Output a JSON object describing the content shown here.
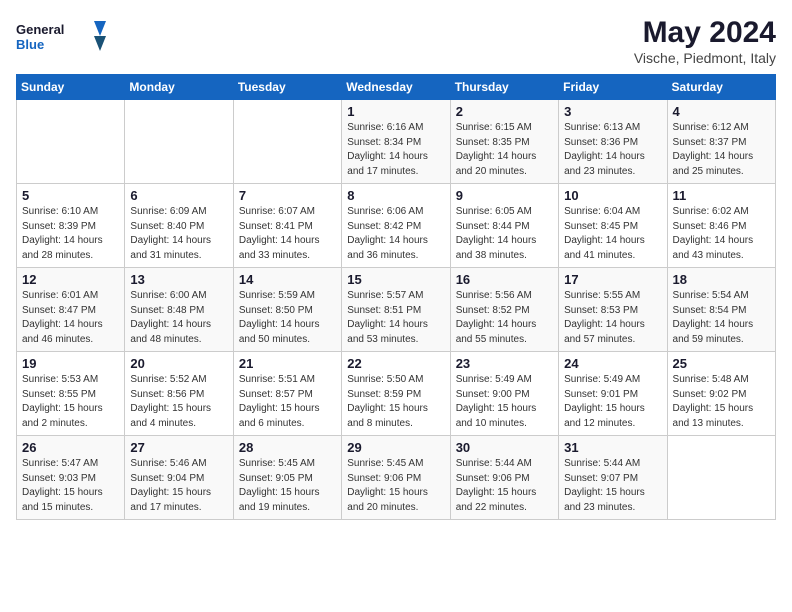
{
  "logo": {
    "general": "General",
    "blue": "Blue"
  },
  "title": "May 2024",
  "subtitle": "Vische, Piedmont, Italy",
  "days_of_week": [
    "Sunday",
    "Monday",
    "Tuesday",
    "Wednesday",
    "Thursday",
    "Friday",
    "Saturday"
  ],
  "weeks": [
    [
      {
        "day": "",
        "info": ""
      },
      {
        "day": "",
        "info": ""
      },
      {
        "day": "",
        "info": ""
      },
      {
        "day": "1",
        "info": "Sunrise: 6:16 AM\nSunset: 8:34 PM\nDaylight: 14 hours\nand 17 minutes."
      },
      {
        "day": "2",
        "info": "Sunrise: 6:15 AM\nSunset: 8:35 PM\nDaylight: 14 hours\nand 20 minutes."
      },
      {
        "day": "3",
        "info": "Sunrise: 6:13 AM\nSunset: 8:36 PM\nDaylight: 14 hours\nand 23 minutes."
      },
      {
        "day": "4",
        "info": "Sunrise: 6:12 AM\nSunset: 8:37 PM\nDaylight: 14 hours\nand 25 minutes."
      }
    ],
    [
      {
        "day": "5",
        "info": "Sunrise: 6:10 AM\nSunset: 8:39 PM\nDaylight: 14 hours\nand 28 minutes."
      },
      {
        "day": "6",
        "info": "Sunrise: 6:09 AM\nSunset: 8:40 PM\nDaylight: 14 hours\nand 31 minutes."
      },
      {
        "day": "7",
        "info": "Sunrise: 6:07 AM\nSunset: 8:41 PM\nDaylight: 14 hours\nand 33 minutes."
      },
      {
        "day": "8",
        "info": "Sunrise: 6:06 AM\nSunset: 8:42 PM\nDaylight: 14 hours\nand 36 minutes."
      },
      {
        "day": "9",
        "info": "Sunrise: 6:05 AM\nSunset: 8:44 PM\nDaylight: 14 hours\nand 38 minutes."
      },
      {
        "day": "10",
        "info": "Sunrise: 6:04 AM\nSunset: 8:45 PM\nDaylight: 14 hours\nand 41 minutes."
      },
      {
        "day": "11",
        "info": "Sunrise: 6:02 AM\nSunset: 8:46 PM\nDaylight: 14 hours\nand 43 minutes."
      }
    ],
    [
      {
        "day": "12",
        "info": "Sunrise: 6:01 AM\nSunset: 8:47 PM\nDaylight: 14 hours\nand 46 minutes."
      },
      {
        "day": "13",
        "info": "Sunrise: 6:00 AM\nSunset: 8:48 PM\nDaylight: 14 hours\nand 48 minutes."
      },
      {
        "day": "14",
        "info": "Sunrise: 5:59 AM\nSunset: 8:50 PM\nDaylight: 14 hours\nand 50 minutes."
      },
      {
        "day": "15",
        "info": "Sunrise: 5:57 AM\nSunset: 8:51 PM\nDaylight: 14 hours\nand 53 minutes."
      },
      {
        "day": "16",
        "info": "Sunrise: 5:56 AM\nSunset: 8:52 PM\nDaylight: 14 hours\nand 55 minutes."
      },
      {
        "day": "17",
        "info": "Sunrise: 5:55 AM\nSunset: 8:53 PM\nDaylight: 14 hours\nand 57 minutes."
      },
      {
        "day": "18",
        "info": "Sunrise: 5:54 AM\nSunset: 8:54 PM\nDaylight: 14 hours\nand 59 minutes."
      }
    ],
    [
      {
        "day": "19",
        "info": "Sunrise: 5:53 AM\nSunset: 8:55 PM\nDaylight: 15 hours\nand 2 minutes."
      },
      {
        "day": "20",
        "info": "Sunrise: 5:52 AM\nSunset: 8:56 PM\nDaylight: 15 hours\nand 4 minutes."
      },
      {
        "day": "21",
        "info": "Sunrise: 5:51 AM\nSunset: 8:57 PM\nDaylight: 15 hours\nand 6 minutes."
      },
      {
        "day": "22",
        "info": "Sunrise: 5:50 AM\nSunset: 8:59 PM\nDaylight: 15 hours\nand 8 minutes."
      },
      {
        "day": "23",
        "info": "Sunrise: 5:49 AM\nSunset: 9:00 PM\nDaylight: 15 hours\nand 10 minutes."
      },
      {
        "day": "24",
        "info": "Sunrise: 5:49 AM\nSunset: 9:01 PM\nDaylight: 15 hours\nand 12 minutes."
      },
      {
        "day": "25",
        "info": "Sunrise: 5:48 AM\nSunset: 9:02 PM\nDaylight: 15 hours\nand 13 minutes."
      }
    ],
    [
      {
        "day": "26",
        "info": "Sunrise: 5:47 AM\nSunset: 9:03 PM\nDaylight: 15 hours\nand 15 minutes."
      },
      {
        "day": "27",
        "info": "Sunrise: 5:46 AM\nSunset: 9:04 PM\nDaylight: 15 hours\nand 17 minutes."
      },
      {
        "day": "28",
        "info": "Sunrise: 5:45 AM\nSunset: 9:05 PM\nDaylight: 15 hours\nand 19 minutes."
      },
      {
        "day": "29",
        "info": "Sunrise: 5:45 AM\nSunset: 9:06 PM\nDaylight: 15 hours\nand 20 minutes."
      },
      {
        "day": "30",
        "info": "Sunrise: 5:44 AM\nSunset: 9:06 PM\nDaylight: 15 hours\nand 22 minutes."
      },
      {
        "day": "31",
        "info": "Sunrise: 5:44 AM\nSunset: 9:07 PM\nDaylight: 15 hours\nand 23 minutes."
      },
      {
        "day": "",
        "info": ""
      }
    ]
  ]
}
